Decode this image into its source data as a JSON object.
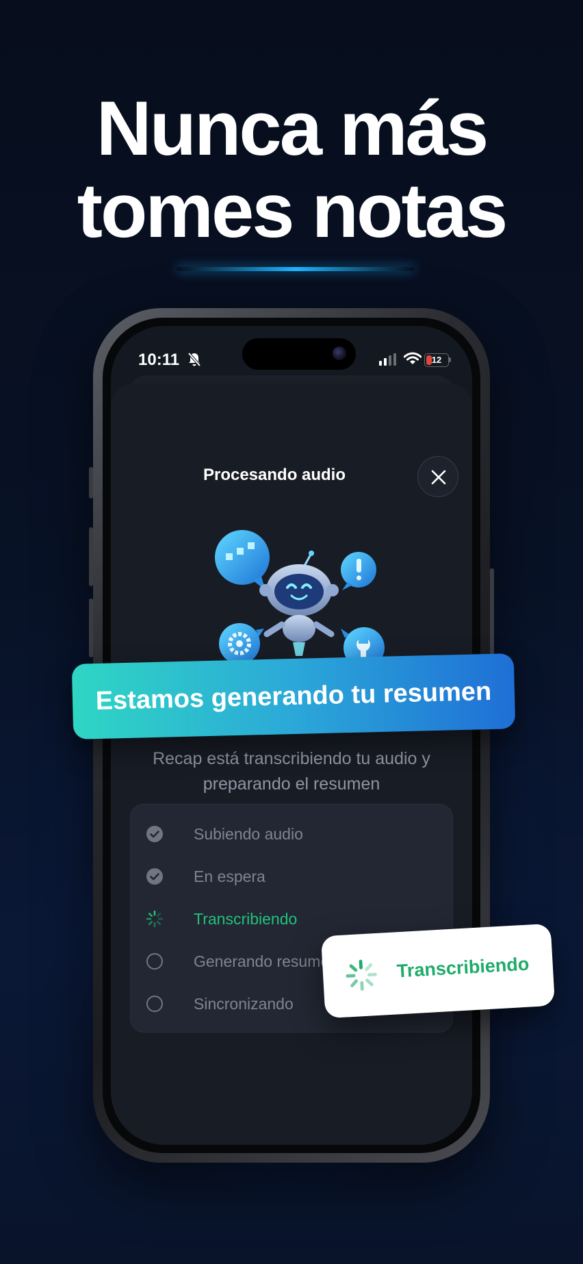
{
  "headline": {
    "line1": "Nunca más",
    "line2": "tomes notas"
  },
  "status_bar": {
    "time": "10:11",
    "battery_level": "12",
    "battery_color": "#e0473b"
  },
  "sheet": {
    "title": "Procesando audio",
    "close_icon": "close-icon"
  },
  "banner": {
    "text": "Estamos generando tu resumen"
  },
  "subtitle": "Recap está transcribiendo tu audio y preparando el resumen",
  "steps": [
    {
      "label": "Subiendo audio",
      "state": "done",
      "icon": "check-circle-icon"
    },
    {
      "label": "En espera",
      "state": "done",
      "icon": "check-circle-icon"
    },
    {
      "label": "Transcribiendo",
      "state": "active",
      "icon": "spinner-icon"
    },
    {
      "label": "Generando resumen",
      "state": "pending",
      "icon": "empty-circle-icon"
    },
    {
      "label": "Sincronizando",
      "state": "pending",
      "icon": "empty-circle-icon"
    }
  ],
  "float_card": {
    "label": "Transcribiendo",
    "icon": "spinner-icon"
  },
  "colors": {
    "accent_green": "#22c27a",
    "banner_start": "#2fd6c4",
    "banner_end": "#1f6fd6",
    "background": "#081226"
  }
}
